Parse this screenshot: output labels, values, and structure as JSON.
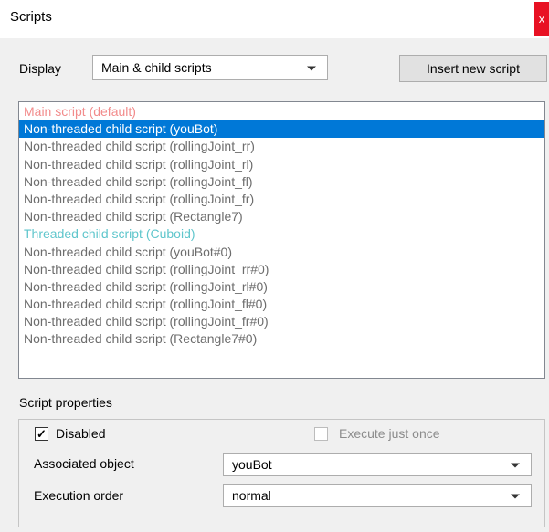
{
  "window": {
    "title": "Scripts",
    "close_glyph": "x"
  },
  "display": {
    "label": "Display",
    "selected": "Main & child scripts",
    "insert_button": "Insert new script"
  },
  "scripts": {
    "selected_index": 1,
    "items": [
      {
        "label": "Main script (default)",
        "kind": "main"
      },
      {
        "label": "Non-threaded child script (youBot)",
        "kind": "child"
      },
      {
        "label": "Non-threaded child script (rollingJoint_rr)",
        "kind": "child"
      },
      {
        "label": "Non-threaded child script (rollingJoint_rl)",
        "kind": "child"
      },
      {
        "label": "Non-threaded child script (rollingJoint_fl)",
        "kind": "child"
      },
      {
        "label": "Non-threaded child script (rollingJoint_fr)",
        "kind": "child"
      },
      {
        "label": "Non-threaded child script (Rectangle7)",
        "kind": "child"
      },
      {
        "label": "Threaded child script (Cuboid)",
        "kind": "threaded"
      },
      {
        "label": "Non-threaded child script (youBot#0)",
        "kind": "child"
      },
      {
        "label": "Non-threaded child script (rollingJoint_rr#0)",
        "kind": "child"
      },
      {
        "label": "Non-threaded child script (rollingJoint_rl#0)",
        "kind": "child"
      },
      {
        "label": "Non-threaded child script (rollingJoint_fl#0)",
        "kind": "child"
      },
      {
        "label": "Non-threaded child script (rollingJoint_fr#0)",
        "kind": "child"
      },
      {
        "label": "Non-threaded child script (Rectangle7#0)",
        "kind": "child"
      }
    ]
  },
  "properties": {
    "section_label": "Script properties",
    "disabled_label": "Disabled",
    "disabled_checked": true,
    "check_glyph": "✓",
    "execute_once_label": "Execute just once",
    "execute_once_checked": false,
    "associated_object_label": "Associated object",
    "associated_object_value": "youBot",
    "execution_order_label": "Execution order",
    "execution_order_value": "normal"
  },
  "colors": {
    "selection": "#0078d7",
    "main_script": "#f28b8b",
    "threaded_script": "#5fc6cc",
    "child_script": "#6d6d6d",
    "close_button": "#e81123"
  }
}
